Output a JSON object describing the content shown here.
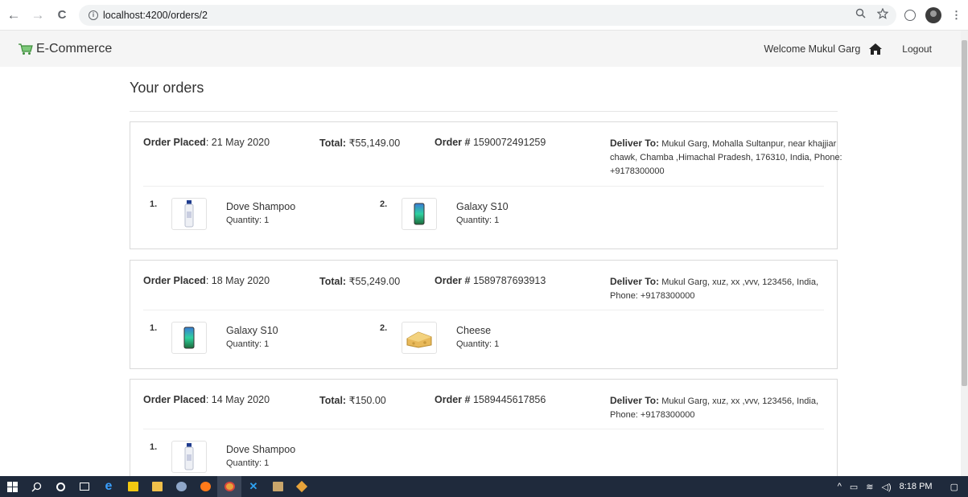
{
  "browser": {
    "url": "localhost:4200/orders/2",
    "back_icon": "←",
    "forward_icon": "→",
    "reload_icon": "C"
  },
  "navbar": {
    "brand": "E-Commerce",
    "welcome": "Welcome Mukul Garg",
    "logout": "Logout"
  },
  "page": {
    "title": "Your orders"
  },
  "labels": {
    "order_placed": "Order Placed",
    "total": "Total:",
    "order_no": "Order #",
    "deliver_to": "Deliver To:",
    "quantity_prefix": "Quantity:"
  },
  "orders": [
    {
      "placed": ": 21 May 2020",
      "total": "₹55,149.00",
      "number": "1590072491259",
      "address": "Mukul Garg, Mohalla Sultanpur, near khajjiar chawk, Chamba ,Himachal Pradesh, 176310, India, Phone: +9178300000",
      "items": [
        {
          "num": "1.",
          "name": "Dove Shampoo",
          "qty": "Quantity: 1",
          "image": "shampoo-bottle"
        },
        {
          "num": "2.",
          "name": "Galaxy S10",
          "qty": "Quantity: 1",
          "image": "smartphone"
        }
      ]
    },
    {
      "placed": ": 18 May 2020",
      "total": "₹55,249.00",
      "number": "1589787693913",
      "address": "Mukul Garg, xuz, xx ,vvv, 123456, India, Phone: +9178300000",
      "items": [
        {
          "num": "1.",
          "name": "Galaxy S10",
          "qty": "Quantity: 1",
          "image": "smartphone"
        },
        {
          "num": "2.",
          "name": "Cheese",
          "qty": "Quantity: 1",
          "image": "cheese"
        }
      ]
    },
    {
      "placed": ": 14 May 2020",
      "total": "₹150.00",
      "number": "1589445617856",
      "address": "Mukul Garg, xuz, xx ,vvv, 123456, India, Phone: +9178300000",
      "items": [
        {
          "num": "1.",
          "name": "Dove Shampoo",
          "qty": "Quantity: 1",
          "image": "shampoo-bottle"
        }
      ]
    }
  ],
  "taskbar": {
    "time": "8:18 PM"
  },
  "colors": {
    "navbar_bg": "#f5f5f5",
    "card_border": "#d9d9d9",
    "taskbar_bg": "#1f2a3c",
    "cart_green": "#5cb85c"
  }
}
